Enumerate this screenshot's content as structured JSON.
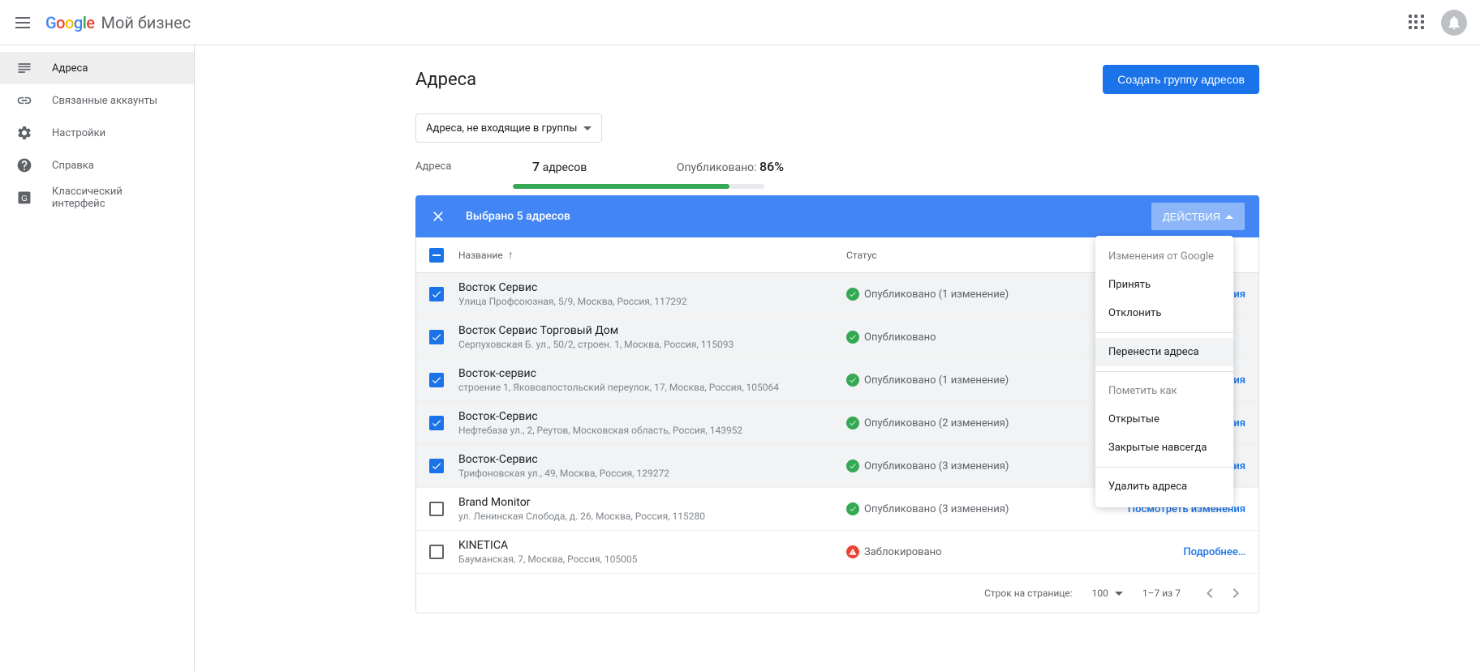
{
  "header": {
    "logo": "Google",
    "product": "Мой бизнес"
  },
  "sidebar": {
    "items": [
      {
        "label": "Адреса",
        "icon": "locations"
      },
      {
        "label": "Связанные аккаунты",
        "icon": "link"
      },
      {
        "label": "Настройки",
        "icon": "gear"
      },
      {
        "label": "Справка",
        "icon": "help"
      },
      {
        "label": "Классический интерфейс",
        "icon": "classic"
      }
    ]
  },
  "page": {
    "title": "Адреса",
    "create_group_btn": "Создать группу адресов",
    "filter": "Адреса, не входящие в группы",
    "stats_label": "Адреса",
    "count_value": "7",
    "count_label": "адресов",
    "published_label": "Опубликовано:",
    "published_percent": "86%",
    "progress_percent": 86
  },
  "selection": {
    "text": "Выбрано 5 адресов",
    "actions_btn": "ДЕЙСТВИЯ"
  },
  "menu": {
    "heading": "Изменения от Google",
    "accept": "Принять",
    "reject": "Отклонить",
    "transfer": "Перенести адреса",
    "mark_as": "Пометить как",
    "open": "Открытые",
    "closed": "Закрытые навсегда",
    "delete": "Удалить адреса"
  },
  "table": {
    "col_name": "Название",
    "col_status": "Статус",
    "view_changes": "Посмотреть изменения",
    "learn_more": "Подробнее…",
    "rows": [
      {
        "checked": true,
        "name": "Восток Сервис",
        "addr": "Улица Профсоюзная, 5/9, Москва, Россия, 117292",
        "status_ok": true,
        "status": "Опубликовано (1 изменение)",
        "action": "view"
      },
      {
        "checked": true,
        "name": "Восток Сервис Торговый Дом",
        "addr": "Серпуховская Б. ул., 50/2, строен. 1, Москва, Россия, 115093",
        "status_ok": true,
        "status": "Опубликовано",
        "action": ""
      },
      {
        "checked": true,
        "name": "Восток-сервис",
        "addr": "строение 1, Яковоапостольский переулок, 17, Москва, Россия, 105064",
        "status_ok": true,
        "status": "Опубликовано (1 изменение)",
        "action": "view"
      },
      {
        "checked": true,
        "name": "Восток-Сервис",
        "addr": "Нефтебаза ул., 2, Реутов, Московская область, Россия, 143952",
        "status_ok": true,
        "status": "Опубликовано (2 изменения)",
        "action": "view"
      },
      {
        "checked": true,
        "name": "Восток-Сервис",
        "addr": "Трифоновская ул., 49, Москва, Россия, 129272",
        "status_ok": true,
        "status": "Опубликовано (3 изменения)",
        "action": "view"
      },
      {
        "checked": false,
        "name": "Brand Monitor",
        "addr": "ул. Ленинская Слобода, д. 26, Москва, Россия, 115280",
        "status_ok": true,
        "status": "Опубликовано (3 изменения)",
        "action": "view"
      },
      {
        "checked": false,
        "name": "KINETICA",
        "addr": "Бауманская, 7, Москва, Россия, 105005",
        "status_ok": false,
        "status": "Заблокировано",
        "action": "more"
      }
    ]
  },
  "footer": {
    "rows_per_page": "Строк на странице:",
    "page_size": "100",
    "range": "1–7 из 7"
  }
}
